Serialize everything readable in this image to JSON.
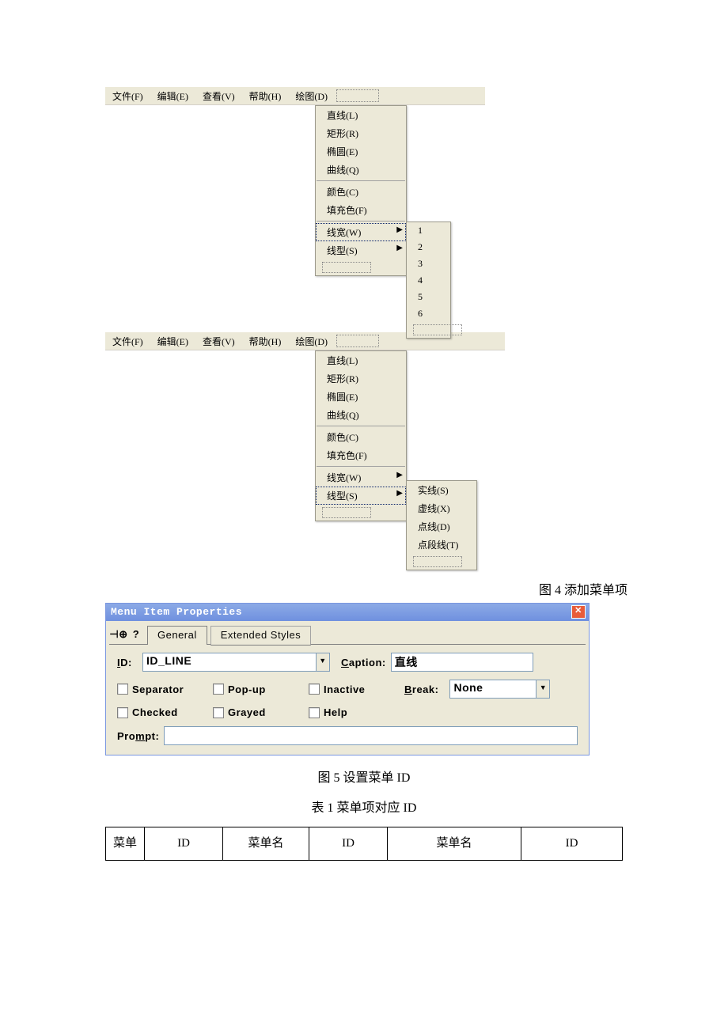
{
  "menubar": {
    "items": [
      "文件(F)",
      "编辑(E)",
      "查看(V)",
      "帮助(H)",
      "绘图(D)"
    ]
  },
  "draw_menu": {
    "group1": [
      "直线(L)",
      "矩形(R)",
      "椭圆(E)",
      "曲线(Q)"
    ],
    "group2": [
      "颜色(C)",
      "填充色(F)"
    ],
    "linewidth": "线宽(W)",
    "linestyle": "线型(S)"
  },
  "width_submenu": [
    "1",
    "2",
    "3",
    "4",
    "5",
    "6"
  ],
  "style_submenu": [
    "实线(S)",
    "虚线(X)",
    "点线(D)",
    "点段线(T)"
  ],
  "fig4_caption": "图 4  添加菜单项",
  "dialog": {
    "title": "Menu Item Properties",
    "tab_general": "General",
    "tab_extended": "Extended Styles",
    "id_label": "ID:",
    "id_value": "ID_LINE",
    "caption_label": "Caption:",
    "caption_value": "直线",
    "chk_separator": "Separator",
    "chk_popup": "Pop-up",
    "chk_inactive": "Inactive",
    "break_label": "Break:",
    "break_value": "None",
    "chk_checked": "Checked",
    "chk_grayed": "Grayed",
    "chk_help": "Help",
    "prompt_label": "Prompt:",
    "prompt_value": ""
  },
  "fig5_caption": "图 5   设置菜单 ID",
  "table1_caption": "表 1   菜单项对应 ID",
  "table": {
    "h1": "菜单",
    "h2": "ID",
    "h3": "菜单名",
    "h4": "ID",
    "h5": "菜单名",
    "h6": "ID"
  }
}
